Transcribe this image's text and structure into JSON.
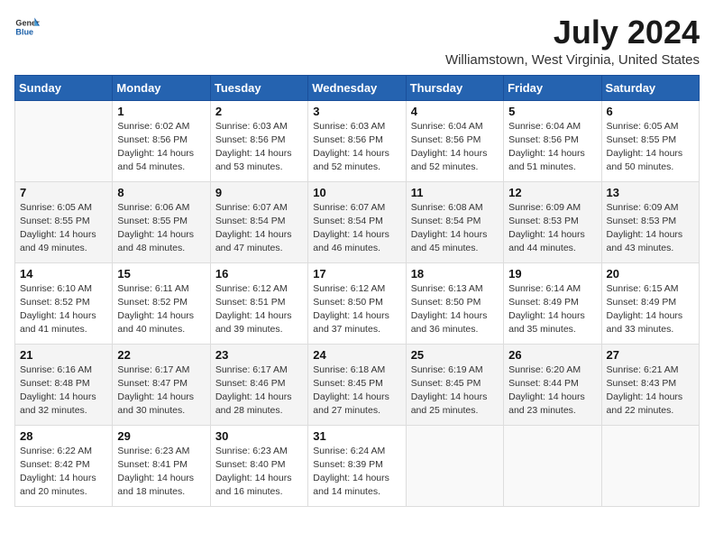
{
  "logo": {
    "text_general": "General",
    "text_blue": "Blue"
  },
  "title": "July 2024",
  "subtitle": "Williamstown, West Virginia, United States",
  "days_header": [
    "Sunday",
    "Monday",
    "Tuesday",
    "Wednesday",
    "Thursday",
    "Friday",
    "Saturday"
  ],
  "weeks": [
    [
      {
        "day": "",
        "sunrise": "",
        "sunset": "",
        "daylight": ""
      },
      {
        "day": "1",
        "sunrise": "Sunrise: 6:02 AM",
        "sunset": "Sunset: 8:56 PM",
        "daylight": "Daylight: 14 hours and 54 minutes."
      },
      {
        "day": "2",
        "sunrise": "Sunrise: 6:03 AM",
        "sunset": "Sunset: 8:56 PM",
        "daylight": "Daylight: 14 hours and 53 minutes."
      },
      {
        "day": "3",
        "sunrise": "Sunrise: 6:03 AM",
        "sunset": "Sunset: 8:56 PM",
        "daylight": "Daylight: 14 hours and 52 minutes."
      },
      {
        "day": "4",
        "sunrise": "Sunrise: 6:04 AM",
        "sunset": "Sunset: 8:56 PM",
        "daylight": "Daylight: 14 hours and 52 minutes."
      },
      {
        "day": "5",
        "sunrise": "Sunrise: 6:04 AM",
        "sunset": "Sunset: 8:56 PM",
        "daylight": "Daylight: 14 hours and 51 minutes."
      },
      {
        "day": "6",
        "sunrise": "Sunrise: 6:05 AM",
        "sunset": "Sunset: 8:55 PM",
        "daylight": "Daylight: 14 hours and 50 minutes."
      }
    ],
    [
      {
        "day": "7",
        "sunrise": "Sunrise: 6:05 AM",
        "sunset": "Sunset: 8:55 PM",
        "daylight": "Daylight: 14 hours and 49 minutes."
      },
      {
        "day": "8",
        "sunrise": "Sunrise: 6:06 AM",
        "sunset": "Sunset: 8:55 PM",
        "daylight": "Daylight: 14 hours and 48 minutes."
      },
      {
        "day": "9",
        "sunrise": "Sunrise: 6:07 AM",
        "sunset": "Sunset: 8:54 PM",
        "daylight": "Daylight: 14 hours and 47 minutes."
      },
      {
        "day": "10",
        "sunrise": "Sunrise: 6:07 AM",
        "sunset": "Sunset: 8:54 PM",
        "daylight": "Daylight: 14 hours and 46 minutes."
      },
      {
        "day": "11",
        "sunrise": "Sunrise: 6:08 AM",
        "sunset": "Sunset: 8:54 PM",
        "daylight": "Daylight: 14 hours and 45 minutes."
      },
      {
        "day": "12",
        "sunrise": "Sunrise: 6:09 AM",
        "sunset": "Sunset: 8:53 PM",
        "daylight": "Daylight: 14 hours and 44 minutes."
      },
      {
        "day": "13",
        "sunrise": "Sunrise: 6:09 AM",
        "sunset": "Sunset: 8:53 PM",
        "daylight": "Daylight: 14 hours and 43 minutes."
      }
    ],
    [
      {
        "day": "14",
        "sunrise": "Sunrise: 6:10 AM",
        "sunset": "Sunset: 8:52 PM",
        "daylight": "Daylight: 14 hours and 41 minutes."
      },
      {
        "day": "15",
        "sunrise": "Sunrise: 6:11 AM",
        "sunset": "Sunset: 8:52 PM",
        "daylight": "Daylight: 14 hours and 40 minutes."
      },
      {
        "day": "16",
        "sunrise": "Sunrise: 6:12 AM",
        "sunset": "Sunset: 8:51 PM",
        "daylight": "Daylight: 14 hours and 39 minutes."
      },
      {
        "day": "17",
        "sunrise": "Sunrise: 6:12 AM",
        "sunset": "Sunset: 8:50 PM",
        "daylight": "Daylight: 14 hours and 37 minutes."
      },
      {
        "day": "18",
        "sunrise": "Sunrise: 6:13 AM",
        "sunset": "Sunset: 8:50 PM",
        "daylight": "Daylight: 14 hours and 36 minutes."
      },
      {
        "day": "19",
        "sunrise": "Sunrise: 6:14 AM",
        "sunset": "Sunset: 8:49 PM",
        "daylight": "Daylight: 14 hours and 35 minutes."
      },
      {
        "day": "20",
        "sunrise": "Sunrise: 6:15 AM",
        "sunset": "Sunset: 8:49 PM",
        "daylight": "Daylight: 14 hours and 33 minutes."
      }
    ],
    [
      {
        "day": "21",
        "sunrise": "Sunrise: 6:16 AM",
        "sunset": "Sunset: 8:48 PM",
        "daylight": "Daylight: 14 hours and 32 minutes."
      },
      {
        "day": "22",
        "sunrise": "Sunrise: 6:17 AM",
        "sunset": "Sunset: 8:47 PM",
        "daylight": "Daylight: 14 hours and 30 minutes."
      },
      {
        "day": "23",
        "sunrise": "Sunrise: 6:17 AM",
        "sunset": "Sunset: 8:46 PM",
        "daylight": "Daylight: 14 hours and 28 minutes."
      },
      {
        "day": "24",
        "sunrise": "Sunrise: 6:18 AM",
        "sunset": "Sunset: 8:45 PM",
        "daylight": "Daylight: 14 hours and 27 minutes."
      },
      {
        "day": "25",
        "sunrise": "Sunrise: 6:19 AM",
        "sunset": "Sunset: 8:45 PM",
        "daylight": "Daylight: 14 hours and 25 minutes."
      },
      {
        "day": "26",
        "sunrise": "Sunrise: 6:20 AM",
        "sunset": "Sunset: 8:44 PM",
        "daylight": "Daylight: 14 hours and 23 minutes."
      },
      {
        "day": "27",
        "sunrise": "Sunrise: 6:21 AM",
        "sunset": "Sunset: 8:43 PM",
        "daylight": "Daylight: 14 hours and 22 minutes."
      }
    ],
    [
      {
        "day": "28",
        "sunrise": "Sunrise: 6:22 AM",
        "sunset": "Sunset: 8:42 PM",
        "daylight": "Daylight: 14 hours and 20 minutes."
      },
      {
        "day": "29",
        "sunrise": "Sunrise: 6:23 AM",
        "sunset": "Sunset: 8:41 PM",
        "daylight": "Daylight: 14 hours and 18 minutes."
      },
      {
        "day": "30",
        "sunrise": "Sunrise: 6:23 AM",
        "sunset": "Sunset: 8:40 PM",
        "daylight": "Daylight: 14 hours and 16 minutes."
      },
      {
        "day": "31",
        "sunrise": "Sunrise: 6:24 AM",
        "sunset": "Sunset: 8:39 PM",
        "daylight": "Daylight: 14 hours and 14 minutes."
      },
      {
        "day": "",
        "sunrise": "",
        "sunset": "",
        "daylight": ""
      },
      {
        "day": "",
        "sunrise": "",
        "sunset": "",
        "daylight": ""
      },
      {
        "day": "",
        "sunrise": "",
        "sunset": "",
        "daylight": ""
      }
    ]
  ]
}
